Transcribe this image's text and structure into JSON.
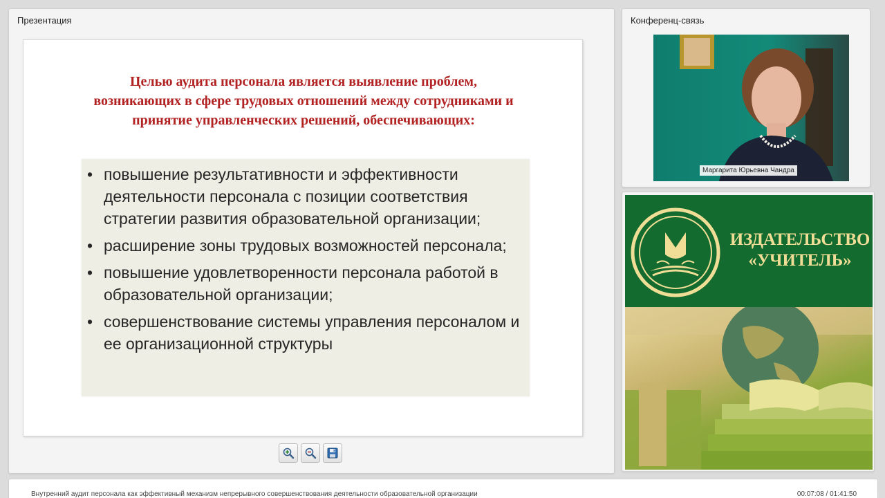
{
  "presentation": {
    "panel_title": "Презентация",
    "slide": {
      "heading": "Целью аудита персонала является выявление проблем, возникающих в сфере трудовых отношений между сотрудниками и принятие управленческих решений, обеспечивающих:",
      "bullets": [
        "повышение результативности и эффективности деятельности персонала с позиции соответствия стратегии развития образовательной организации;",
        "расширение зоны трудовых возможностей персонала;",
        "повышение удовлетворенности персонала работой в образовательной организации;",
        "совершенствование системы управления персоналом и ее организационной структуры"
      ],
      "bullet_symbol": "•"
    },
    "toolbar": {
      "zoom_in_icon": "zoom-in-icon",
      "zoom_out_icon": "zoom-out-icon",
      "save_icon": "floppy-disk-icon"
    }
  },
  "conference": {
    "panel_title": "Конференц-связь",
    "participant_name": "Маргарита Юрьевна Чандра"
  },
  "promo": {
    "title_line1": "ИЗДАТЕЛЬСТВО",
    "title_line2": "«УЧИТЕЛЬ»"
  },
  "footer": {
    "lecture_title": "Внутренний аудит персонала как эффективный механизм непрерывного совершенствования деятельности образовательной организации",
    "timer": "00:07:08 / 01:41:50"
  },
  "colors": {
    "heading_red": "#b22222",
    "promo_green": "#136b2f",
    "promo_gold": "#f1de96",
    "bullet_box_bg": "#eeeee4"
  }
}
